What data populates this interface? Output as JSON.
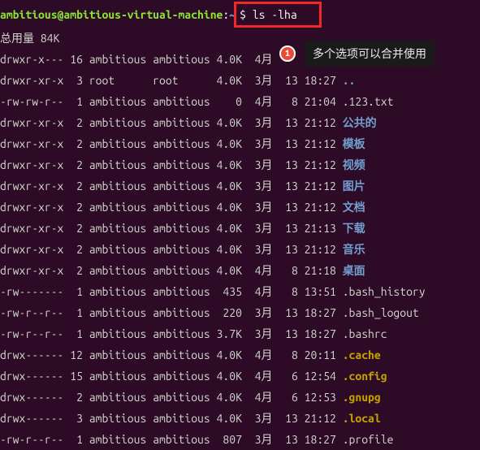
{
  "prompt": {
    "user_host": "ambitious@ambitious-virtual-machine",
    "colon": ":",
    "path": "~",
    "dollar": "$ ",
    "command": "ls -lha"
  },
  "total_line": "总用量 84K",
  "annotation": {
    "number": "1",
    "text": "多个选项可以合并使用"
  },
  "rows": [
    {
      "perm": "drwxr-x---",
      "links": "16",
      "owner": "ambitious",
      "group": "ambitious",
      "size": "4.0K",
      "month": "4月",
      "day": "  ",
      "time": "     ",
      "name": ".",
      "class": "dir-link"
    },
    {
      "perm": "drwxr-xr-x",
      "links": " 3",
      "owner": "root     ",
      "group": "root     ",
      "size": "4.0K",
      "month": "3月",
      "day": "13",
      "time": "18:27",
      "name": "..",
      "class": "dir-link"
    },
    {
      "perm": "-rw-rw-r--",
      "links": " 1",
      "owner": "ambitious",
      "group": "ambitious",
      "size": "   0",
      "month": "4月",
      "day": " 8",
      "time": "21:04",
      "name": ".123.txt",
      "class": "normal-file"
    },
    {
      "perm": "drwxr-xr-x",
      "links": " 2",
      "owner": "ambitious",
      "group": "ambitious",
      "size": "4.0K",
      "month": "3月",
      "day": "13",
      "time": "21:12",
      "name": "公共的",
      "class": "dir-link"
    },
    {
      "perm": "drwxr-xr-x",
      "links": " 2",
      "owner": "ambitious",
      "group": "ambitious",
      "size": "4.0K",
      "month": "3月",
      "day": "13",
      "time": "21:12",
      "name": "模板",
      "class": "dir-link"
    },
    {
      "perm": "drwxr-xr-x",
      "links": " 2",
      "owner": "ambitious",
      "group": "ambitious",
      "size": "4.0K",
      "month": "3月",
      "day": "13",
      "time": "21:12",
      "name": "视频",
      "class": "dir-link"
    },
    {
      "perm": "drwxr-xr-x",
      "links": " 2",
      "owner": "ambitious",
      "group": "ambitious",
      "size": "4.0K",
      "month": "3月",
      "day": "13",
      "time": "21:12",
      "name": "图片",
      "class": "dir-link"
    },
    {
      "perm": "drwxr-xr-x",
      "links": " 2",
      "owner": "ambitious",
      "group": "ambitious",
      "size": "4.0K",
      "month": "3月",
      "day": "13",
      "time": "21:12",
      "name": "文档",
      "class": "dir-link"
    },
    {
      "perm": "drwxr-xr-x",
      "links": " 2",
      "owner": "ambitious",
      "group": "ambitious",
      "size": "4.0K",
      "month": "3月",
      "day": "13",
      "time": "21:13",
      "name": "下载",
      "class": "dir-link"
    },
    {
      "perm": "drwxr-xr-x",
      "links": " 2",
      "owner": "ambitious",
      "group": "ambitious",
      "size": "4.0K",
      "month": "3月",
      "day": "13",
      "time": "21:12",
      "name": "音乐",
      "class": "dir-link"
    },
    {
      "perm": "drwxr-xr-x",
      "links": " 2",
      "owner": "ambitious",
      "group": "ambitious",
      "size": "4.0K",
      "month": "4月",
      "day": " 8",
      "time": "21:18",
      "name": "桌面",
      "class": "dir-link"
    },
    {
      "perm": "-rw-------",
      "links": " 1",
      "owner": "ambitious",
      "group": "ambitious",
      "size": " 435",
      "month": "4月",
      "day": " 8",
      "time": "13:51",
      "name": ".bash_history",
      "class": "normal-file"
    },
    {
      "perm": "-rw-r--r--",
      "links": " 1",
      "owner": "ambitious",
      "group": "ambitious",
      "size": " 220",
      "month": "3月",
      "day": "13",
      "time": "18:27",
      "name": ".bash_logout",
      "class": "normal-file"
    },
    {
      "perm": "-rw-r--r--",
      "links": " 1",
      "owner": "ambitious",
      "group": "ambitious",
      "size": "3.7K",
      "month": "3月",
      "day": "13",
      "time": "18:27",
      "name": ".bashrc",
      "class": "normal-file"
    },
    {
      "perm": "drwx------",
      "links": "12",
      "owner": "ambitious",
      "group": "ambitious",
      "size": "4.0K",
      "month": "4月",
      "day": " 8",
      "time": "20:11",
      "name": ".cache",
      "class": "hidden-dir"
    },
    {
      "perm": "drwx------",
      "links": "15",
      "owner": "ambitious",
      "group": "ambitious",
      "size": "4.0K",
      "month": "4月",
      "day": " 6",
      "time": "12:54",
      "name": ".config",
      "class": "hidden-dir"
    },
    {
      "perm": "drwx------",
      "links": " 2",
      "owner": "ambitious",
      "group": "ambitious",
      "size": "4.0K",
      "month": "4月",
      "day": " 6",
      "time": "12:53",
      "name": ".gnupg",
      "class": "hidden-dir"
    },
    {
      "perm": "drwx------",
      "links": " 3",
      "owner": "ambitious",
      "group": "ambitious",
      "size": "4.0K",
      "month": "3月",
      "day": "13",
      "time": "21:12",
      "name": ".local",
      "class": "hidden-dir"
    },
    {
      "perm": "-rw-r--r--",
      "links": " 1",
      "owner": "ambitious",
      "group": "ambitious",
      "size": " 807",
      "month": "3月",
      "day": "13",
      "time": "18:27",
      "name": ".profile",
      "class": "normal-file"
    }
  ]
}
